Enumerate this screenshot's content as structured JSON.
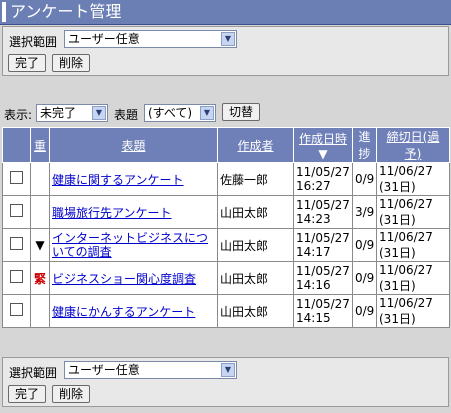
{
  "window": {
    "title": "アンケート管理"
  },
  "top_panel": {
    "range_label": "選択範囲",
    "range_value": "ユーザー任意",
    "complete_button": "完了",
    "delete_button": "削除"
  },
  "filter": {
    "display_label": "表示:",
    "display_value": "未完了",
    "title_label": "表題",
    "title_value": "(すべて)",
    "switch_button": "切替"
  },
  "table": {
    "headers": {
      "priority": "重",
      "title": "表題",
      "author": "作成者",
      "created_line1": "作成日時",
      "created_sort": "▼",
      "progress_line1": "進",
      "progress_line2": "捗",
      "deadline_line1": "締切日(過",
      "deadline_line2": "予)"
    },
    "rows": [
      {
        "priority": "",
        "title": "健康に関するアンケート",
        "author": "佐藤一郎",
        "created_date": "11/05/27",
        "created_time": "16:27",
        "progress": "0/9",
        "deadline_date": "11/06/27",
        "deadline_rel": "(31日)"
      },
      {
        "priority": "",
        "title": "職場旅行先アンケート",
        "author": "山田太郎",
        "created_date": "11/05/27",
        "created_time": "14:23",
        "progress": "3/9",
        "deadline_date": "11/06/27",
        "deadline_rel": "(31日)"
      },
      {
        "priority": "▼",
        "title": "インターネットビジネスについての調査",
        "author": "山田太郎",
        "created_date": "11/05/27",
        "created_time": "14:17",
        "progress": "0/9",
        "deadline_date": "11/06/27",
        "deadline_rel": "(31日)"
      },
      {
        "priority": "緊",
        "title": "ビジネスショー関心度調査",
        "author": "山田太郎",
        "created_date": "11/05/27",
        "created_time": "14:16",
        "progress": "0/9",
        "deadline_date": "11/06/27",
        "deadline_rel": "(31日)"
      },
      {
        "priority": "",
        "title": "健康にかんするアンケート",
        "author": "山田太郎",
        "created_date": "11/05/27",
        "created_time": "14:15",
        "progress": "0/9",
        "deadline_date": "11/06/27",
        "deadline_rel": "(31日)"
      }
    ]
  },
  "bottom_panel": {
    "range_label": "選択範囲",
    "range_value": "ユーザー任意",
    "complete_button": "完了",
    "delete_button": "削除"
  }
}
